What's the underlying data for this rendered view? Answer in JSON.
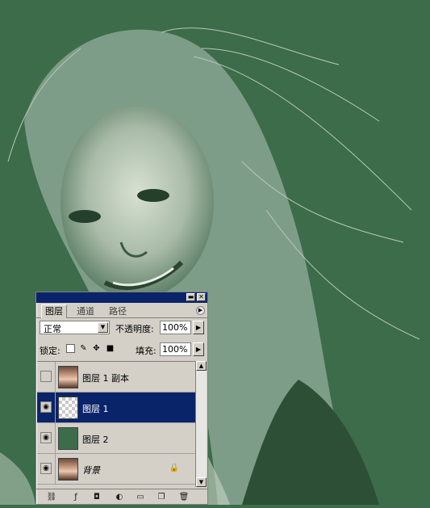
{
  "panel": {
    "tabs": [
      {
        "label": "图层",
        "active": true
      },
      {
        "label": "通道",
        "active": false
      },
      {
        "label": "路径",
        "active": false
      }
    ],
    "blend_mode": "正常",
    "opacity_label": "不透明度:",
    "opacity_value": "100%",
    "lock_label": "锁定:",
    "fill_label": "填充:",
    "fill_value": "100%",
    "layers": [
      {
        "name": "图层 1 副本",
        "visible": false,
        "selected": false,
        "thumb": "photo"
      },
      {
        "name": "图层 1",
        "visible": true,
        "selected": true,
        "thumb": "checker"
      },
      {
        "name": "图层 2",
        "visible": true,
        "selected": false,
        "thumb": "green"
      },
      {
        "name": "背景",
        "visible": true,
        "selected": false,
        "thumb": "photo",
        "locked": true
      }
    ]
  },
  "colors": {
    "canvas_bg": "#3c6c4a",
    "panel_bg": "#d4d0c8",
    "selection": "#0a246a"
  }
}
